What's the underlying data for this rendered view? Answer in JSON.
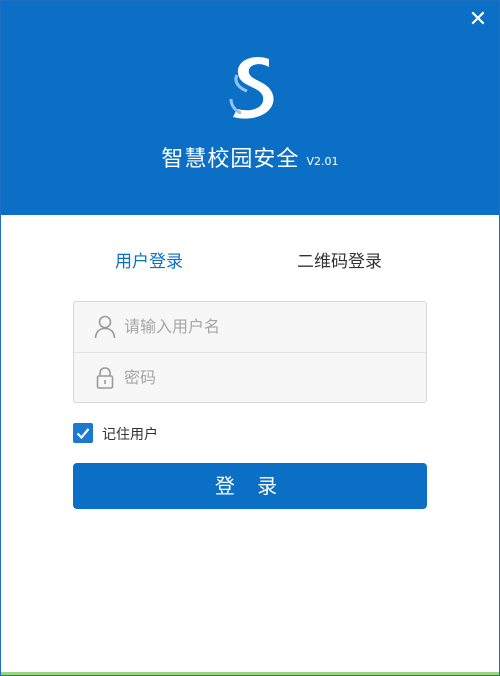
{
  "header": {
    "close_symbol": "✕",
    "app_name": "智慧校园安全",
    "app_version": "V2.01",
    "logo_icon": "stylized-s-logo"
  },
  "tabs": [
    {
      "label": "用户登录",
      "active": true
    },
    {
      "label": "二维码登录",
      "active": false
    }
  ],
  "form": {
    "username": {
      "value": "",
      "placeholder": "请输入用户名",
      "icon": "user-icon"
    },
    "password": {
      "value": "",
      "placeholder": "密码",
      "icon": "lock-icon"
    },
    "remember": {
      "label": "记住用户",
      "checked": true
    },
    "login_button": "登 录"
  },
  "colors": {
    "primary": "#0b6fc6",
    "checkbox": "#1b79d1",
    "bottom_accent": "#9bd77a"
  }
}
